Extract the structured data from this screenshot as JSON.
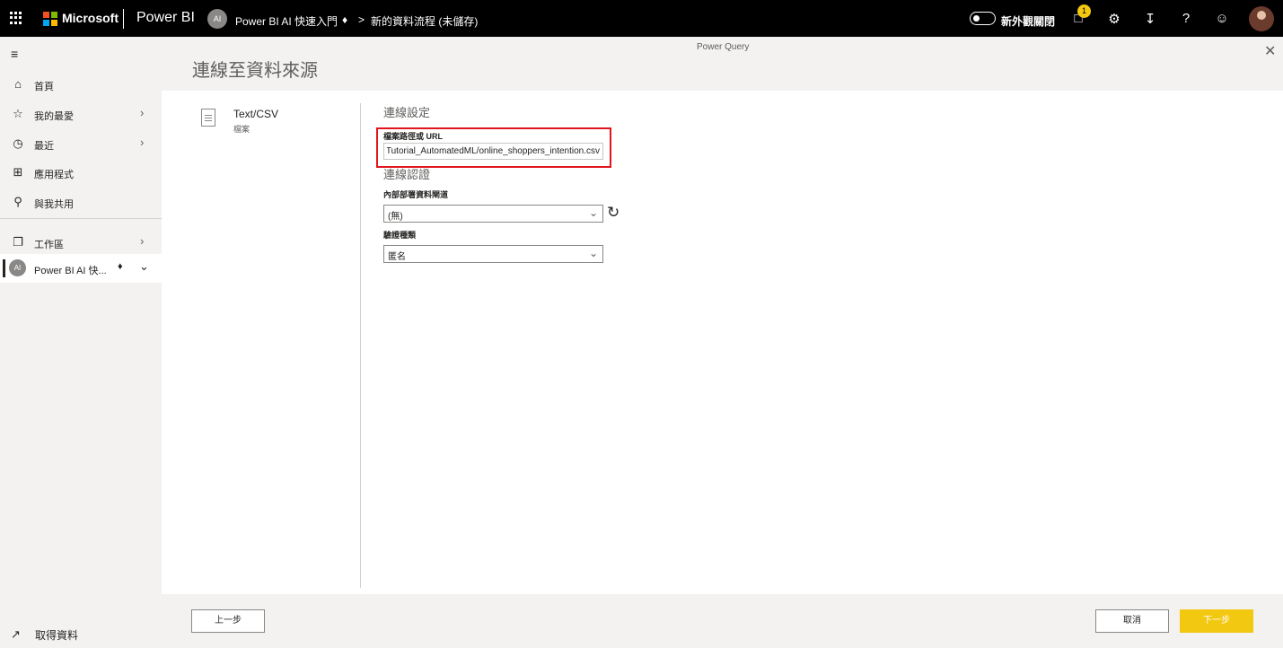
{
  "topbar": {
    "brand": "Microsoft",
    "product": "Power BI",
    "workspace_avatar": "AI",
    "workspace": "Power BI AI 快速入門",
    "premium_icon": "diamond-icon",
    "separator": ">",
    "dataflow": "新的資料流程 (未儲存)",
    "toggle_label": "新外觀關閉",
    "notification_count": "1",
    "icons": [
      "waffle-icon",
      "feedback-icon",
      "gear-icon",
      "download-icon",
      "help-icon",
      "smiley-icon"
    ],
    "colors": {
      "bar": "#000000",
      "badge": "#f2c811"
    }
  },
  "sidebar": {
    "items": [
      {
        "label": "首頁",
        "icon": "home-icon"
      },
      {
        "label": "我的最愛",
        "icon": "star-icon"
      },
      {
        "label": "最近",
        "icon": "clock-icon"
      },
      {
        "label": "應用程式",
        "icon": "apps-icon"
      },
      {
        "label": "與我共用",
        "icon": "people-icon"
      },
      {
        "label": "工作區",
        "icon": "workspace-icon"
      }
    ],
    "current_workspace": {
      "avatar": "AI",
      "label": "Power BI AI 快..."
    },
    "get_data": "取得資料"
  },
  "main": {
    "app_label": "Power Query",
    "title": "連線至資料來源",
    "source": {
      "name": "Text/CSV",
      "type": "檔案"
    },
    "connection_settings": {
      "title": "連線設定",
      "path_label": "檔案路徑或 URL",
      "path_value": "https://raw.githubusercontent.com/Microsoft/PowerBI-tutorials/master/Tutorial_AutomatedML/online_shoppers_intention.csv"
    },
    "credentials": {
      "title": "連線認證",
      "gateway_label": "內部部署資料閘道",
      "gateway_value": "(無)",
      "auth_label": "驗證種類",
      "auth_value": "匿名"
    }
  },
  "footer": {
    "back": "上一步",
    "cancel": "取消",
    "next": "下一步",
    "accent": "#f2c811"
  }
}
